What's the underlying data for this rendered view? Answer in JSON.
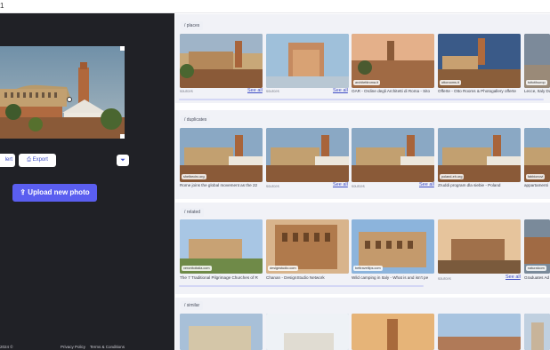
{
  "topbar": {
    "text": "1"
  },
  "left_panel": {
    "alert_label": "lert",
    "export_label": "Export",
    "upload_label": "Upload new photo",
    "footer": {
      "copyright": "2024 ©",
      "privacy": "Privacy Policy",
      "terms": "Terms & Conditions"
    }
  },
  "sections": [
    {
      "tag": "/ places",
      "sources_label": "sources",
      "see_all": "See all",
      "items": [
        {
          "label": "",
          "badge": ""
        },
        {
          "label": "",
          "badge": ""
        },
        {
          "label": "OAR - Ordine degli Architetti di Roma - Sito",
          "badge": "architettiroma.it"
        },
        {
          "label": "Offerte - Otto Rooms & Photogallery offerte",
          "badge": "ottorooms.it"
        },
        {
          "label": "Lecce, Italy Da",
          "badge": "tuttotilsurop"
        }
      ]
    },
    {
      "tag": "/ duplicates",
      "sources_label": "sources",
      "see_all": "See all",
      "items": [
        {
          "label": "Rome joins the global movement as the 22",
          "badge": "shelbecirc.org"
        },
        {
          "label": "",
          "badge": ""
        },
        {
          "label": "",
          "badge": ""
        },
        {
          "label": "Zruddi program dla siebie - Poland",
          "badge": "poland-eh.org"
        },
        {
          "label": "appartamenti",
          "badge": "fabbionovi"
        }
      ]
    },
    {
      "tag": "/ related",
      "sources_label": "sources",
      "see_all": "See all",
      "items": [
        {
          "label": "The 7 Traditional Pilgrimage Churches of R",
          "badge": "veronitoitalia.com"
        },
        {
          "label": "Chanan - DesignStudio Network",
          "badge": "designstudio.com"
        },
        {
          "label": "Wild camping in Italy - What is and isn't pe",
          "badge": "bettraveltips.com"
        },
        {
          "label": "",
          "badge": ""
        },
        {
          "label": "Graduates Ad",
          "badge": "naturalcom"
        }
      ]
    },
    {
      "tag": "/ similar",
      "items": []
    }
  ],
  "colors": {
    "sidebar_bg": "#202126",
    "accent": "#5a5ef0",
    "link": "#3d4cc4",
    "section_bg": "#f1f2f7"
  }
}
